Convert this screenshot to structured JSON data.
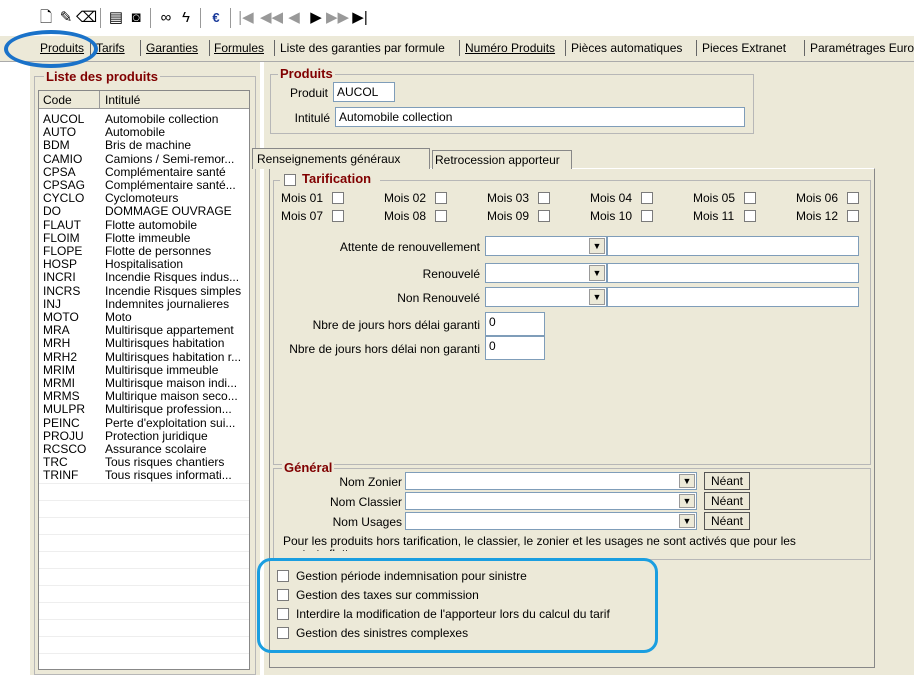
{
  "toolbar": {
    "icons": [
      "new-icon",
      "edit-icon",
      "erase-icon",
      "list-view-icon",
      "camera-icon",
      "binoculars-icon",
      "lightning-icon",
      "euro-icon",
      "first-icon",
      "prev-page-icon",
      "prev-icon",
      "next-icon",
      "next-page-icon",
      "last-icon"
    ]
  },
  "tabs": [
    {
      "label": "Produits"
    },
    {
      "label": "Tarifs"
    },
    {
      "label": "Garanties"
    },
    {
      "label": "Formules"
    },
    {
      "label": "Liste des garanties par formule"
    },
    {
      "label": "Numéro Produits"
    },
    {
      "label": "Pièces automatiques"
    },
    {
      "label": "Pieces Extranet"
    },
    {
      "label": "Paramétrages Euro"
    }
  ],
  "product_list": {
    "title": "Liste des produits",
    "headers": {
      "code": "Code",
      "label": "Intitulé"
    },
    "rows": [
      {
        "code": "AUCOL",
        "label": "Automobile collection"
      },
      {
        "code": "AUTO",
        "label": "Automobile"
      },
      {
        "code": "BDM",
        "label": "Bris de machine"
      },
      {
        "code": "CAMIO",
        "label": "Camions / Semi-remor..."
      },
      {
        "code": "CPSA",
        "label": "Complémentaire santé"
      },
      {
        "code": "CPSAG",
        "label": "Complémentaire santé..."
      },
      {
        "code": "CYCLO",
        "label": "Cyclomoteurs"
      },
      {
        "code": "DO",
        "label": "DOMMAGE OUVRAGE"
      },
      {
        "code": "FLAUT",
        "label": "Flotte automobile"
      },
      {
        "code": "FLOIM",
        "label": "Flotte immeuble"
      },
      {
        "code": "FLOPE",
        "label": "Flotte de personnes"
      },
      {
        "code": "HOSP",
        "label": "Hospitalisation"
      },
      {
        "code": "INCRI",
        "label": "Incendie Risques indus..."
      },
      {
        "code": "INCRS",
        "label": "Incendie Risques simples"
      },
      {
        "code": "INJ",
        "label": "Indemnites journalieres"
      },
      {
        "code": "MOTO",
        "label": "Moto"
      },
      {
        "code": "MRA",
        "label": "Multirisque appartement"
      },
      {
        "code": "MRH",
        "label": "Multirisques habitation"
      },
      {
        "code": "MRH2",
        "label": "Multirisques habitation r..."
      },
      {
        "code": "MRIM",
        "label": "Multirisque immeuble"
      },
      {
        "code": "MRMI",
        "label": "Multirisque maison indi..."
      },
      {
        "code": "MRMS",
        "label": "Multirique maison seco..."
      },
      {
        "code": "MULPR",
        "label": "Multirisque profession..."
      },
      {
        "code": "PEINC",
        "label": "Perte d'exploitation sui..."
      },
      {
        "code": "PROJU",
        "label": "Protection juridique"
      },
      {
        "code": "RCSCO",
        "label": "Assurance scolaire"
      },
      {
        "code": "TRC",
        "label": "Tous risques chantiers"
      },
      {
        "code": "TRINF",
        "label": "Tous risques informati..."
      }
    ]
  },
  "produits": {
    "title": "Produits",
    "produit_label": "Produit",
    "produit_value": "AUCOL",
    "intitule_label": "Intitulé",
    "intitule_value": "Automobile collection"
  },
  "subtabs": [
    "Renseignements généraux",
    "Retrocession apporteur"
  ],
  "tarification": {
    "title": "Tarification",
    "months": [
      "Mois 01",
      "Mois 02",
      "Mois 03",
      "Mois 04",
      "Mois 05",
      "Mois 06",
      "Mois 07",
      "Mois 08",
      "Mois 09",
      "Mois 10",
      "Mois 11",
      "Mois 12"
    ],
    "attente_label": "Attente de renouvellement",
    "renouvele_label": "Renouvelé",
    "non_renouvele_label": "Non Renouvelé",
    "jours_garanti_label": "Nbre de jours hors délai garanti",
    "jours_garanti_value": "0",
    "jours_non_garanti_label": "Nbre de jours hors délai non garanti",
    "jours_non_garanti_value": "0"
  },
  "general": {
    "title": "Général",
    "zonier_label": "Nom Zonier",
    "classier_label": "Nom Classier",
    "usages_label": "Nom Usages",
    "neant": "Néant",
    "note": "Pour les produits hors tarification, le classier, le zonier et les usages ne sont activés que pour les contrats flotte"
  },
  "options": [
    "Gestion période indemnisation pour sinistre",
    "Gestion des taxes sur commission",
    "Interdire la modification de l'apporteur lors du calcul du tarif",
    "Gestion des sinistres complexes"
  ],
  "colors": {
    "accent": "#1a72c9",
    "highlight": "#1a9ee0",
    "legend": "#800000"
  }
}
